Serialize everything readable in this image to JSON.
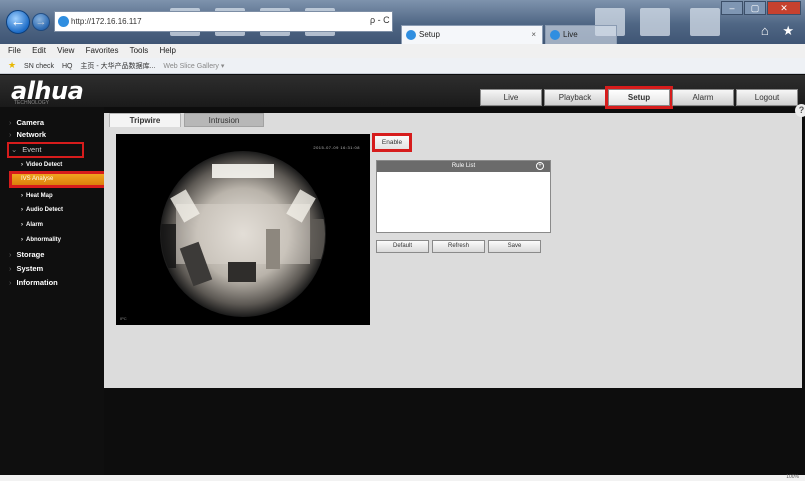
{
  "browser": {
    "address": "http://172.16.16.117",
    "addr_tools": "ρ - C",
    "tabs": [
      {
        "label": "Setup"
      },
      {
        "label": "Live"
      }
    ],
    "tab_close": "×",
    "menu": [
      "File",
      "Edit",
      "View",
      "Favorites",
      "Tools",
      "Help"
    ],
    "favorites": [
      "SN check",
      "HQ",
      "主页 - 大华产品数据库...",
      "Web Slice Gallery ▾"
    ],
    "window_controls": {
      "minimize": "–",
      "maximize": "▢",
      "close": "✕"
    },
    "right_icons": "⌂ ★"
  },
  "app": {
    "logo": "alhua",
    "logo_sub": "TECHNOLOGY",
    "top_nav": [
      "Live",
      "Playback",
      "Setup",
      "Alarm",
      "Logout"
    ],
    "active_nav": "Setup"
  },
  "sidebar": {
    "items": [
      {
        "label": "Camera"
      },
      {
        "label": "Network"
      },
      {
        "label": "Event"
      },
      {
        "label": "Storage"
      },
      {
        "label": "System"
      },
      {
        "label": "Information"
      }
    ],
    "event_sub": [
      "Video Detect",
      "IVS Analyse",
      "Heat Map",
      "Audio Detect",
      "Alarm",
      "Abnormality"
    ],
    "selected_sub": "IVS Analyse"
  },
  "main": {
    "tabs": [
      "Tripwire",
      "Intrusion"
    ],
    "active_tab": "Tripwire",
    "help": "?",
    "video": {
      "timestamp": "2015-07-09 16:31:08",
      "channel": "IPC"
    },
    "enable_label": "Enable",
    "rule_list": {
      "title": "Rule List",
      "add": "+"
    },
    "buttons": [
      "Default",
      "Refresh",
      "Save"
    ]
  },
  "colors": {
    "highlight": "#d61c1c",
    "selected_item": "#e98f12",
    "panel": "#dcdcdc",
    "header": "#1f1f1f"
  },
  "status": {
    "zoom": "100%"
  }
}
